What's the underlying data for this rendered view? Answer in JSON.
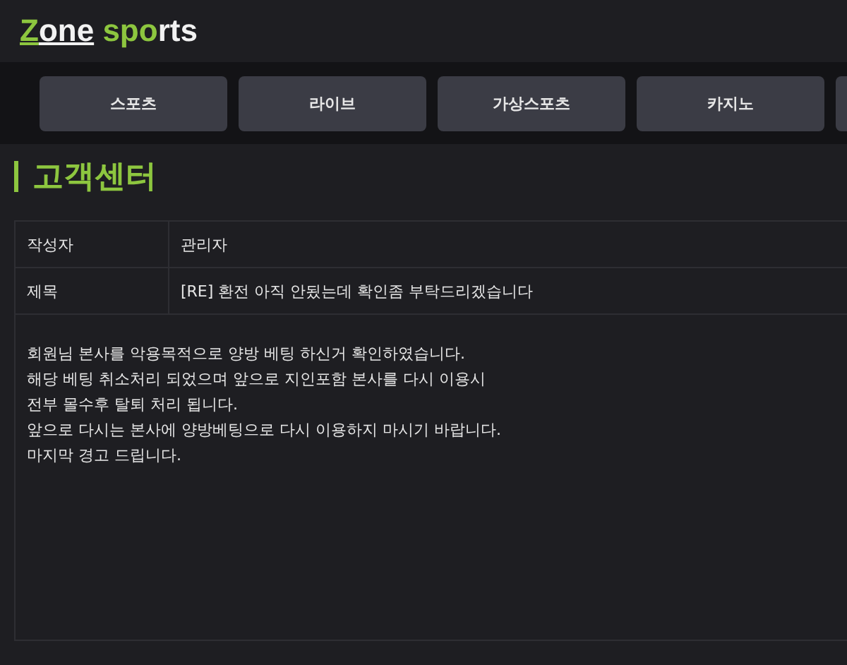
{
  "logo": {
    "parts": [
      {
        "text": "Z",
        "accent": true,
        "underline": true
      },
      {
        "text": "one",
        "accent": false,
        "underline": true
      },
      {
        "text": " spo",
        "accent": true,
        "underline": false
      },
      {
        "text": "rts",
        "accent": false,
        "underline": false
      }
    ]
  },
  "nav": [
    {
      "label": "스포츠"
    },
    {
      "label": "라이브"
    },
    {
      "label": "가상스포츠"
    },
    {
      "label": "카지노"
    }
  ],
  "page_title": "고객센터",
  "fields": [
    {
      "label": "작성자",
      "value": "관리자"
    },
    {
      "label": "제목",
      "value": "[RE] 환전 아직 안됬는데 확인좀 부탁드리겠습니다"
    }
  ],
  "body_lines": [
    "회원님 본사를 악용목적으로 양방 베팅 하신거 확인하였습니다.",
    "해당 베팅 취소처리 되었으며 앞으로 지인포함 본사를 다시 이용시",
    "전부 몰수후 탈퇴 처리 됩니다.",
    "앞으로 다시는 본사에 양방베팅으로 다시 이용하지 마시기 바랍니다.",
    "마지막 경고 드립니다."
  ]
}
